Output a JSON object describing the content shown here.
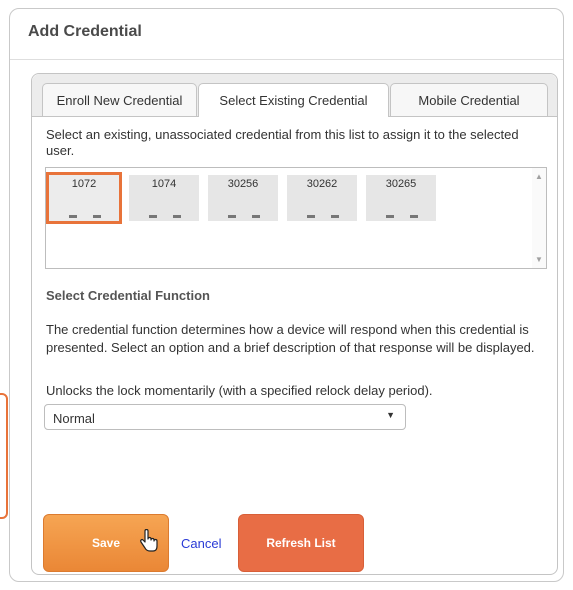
{
  "dialog": {
    "title": "Add Credential"
  },
  "tabs": [
    {
      "label": "Enroll New Credential"
    },
    {
      "label": "Select Existing Credential",
      "active": true
    },
    {
      "label": "Mobile Credential"
    }
  ],
  "instruction": "Select an existing, unassociated credential from this list to assign it to the selected user.",
  "credentials": [
    {
      "id": "1072",
      "selected": true
    },
    {
      "id": "1074"
    },
    {
      "id": "30256"
    },
    {
      "id": "30262"
    },
    {
      "id": "30265"
    }
  ],
  "credential_function": {
    "title": "Select Credential Function",
    "description": "The credential function determines how a device will respond when this credential is presented. Select an option and a brief description of that response will be displayed.",
    "summary": "Unlocks the lock momentarily (with a specified relock delay period).",
    "selected_value": "Normal"
  },
  "buttons": {
    "save": "Save",
    "cancel": "Cancel",
    "refresh": "Refresh List"
  },
  "colors": {
    "accent": "#e8733a",
    "save": "#f19a48",
    "refresh": "#e86d45",
    "link": "#2a3bd6"
  }
}
